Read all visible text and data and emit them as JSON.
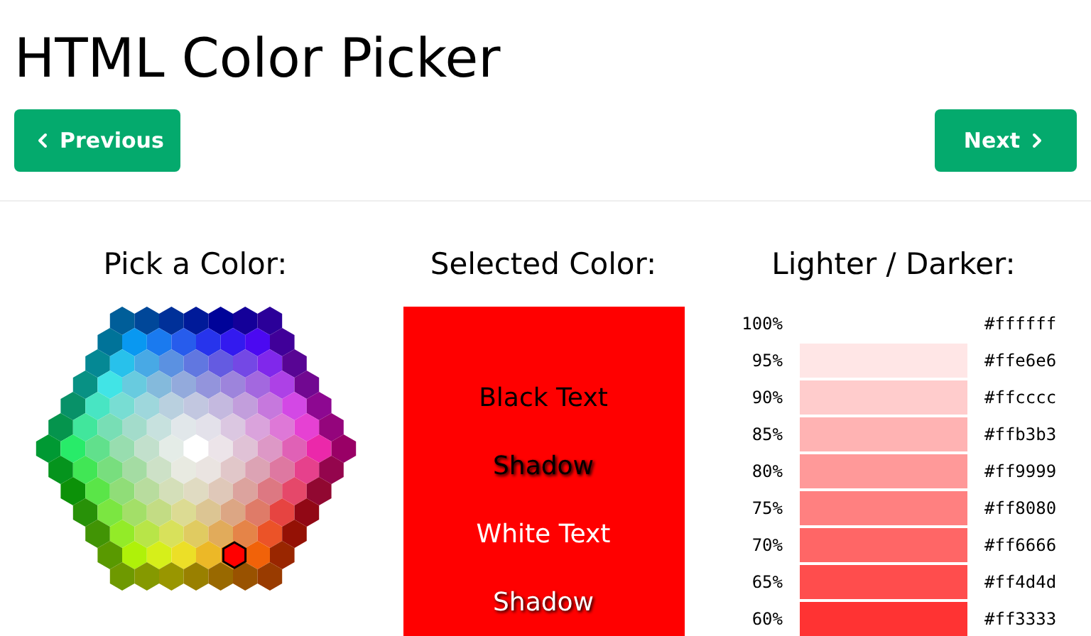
{
  "title": "HTML Color Picker",
  "nav": {
    "previous": "Previous",
    "next": "Next"
  },
  "picker": {
    "heading": "Pick a Color:"
  },
  "selected": {
    "heading": "Selected Color:",
    "color": "#ff0000",
    "samples": [
      {
        "label": "Black Text",
        "kind": "dark"
      },
      {
        "label": "Shadow",
        "kind": "dark-shadow"
      },
      {
        "label": "White Text",
        "kind": "light"
      },
      {
        "label": "Shadow",
        "kind": "light-shadow"
      }
    ]
  },
  "shades": {
    "heading": "Lighter / Darker:",
    "rows": [
      {
        "percent": "100%",
        "hex": "#ffffff"
      },
      {
        "percent": "95%",
        "hex": "#ffe6e6",
        "color": "#ffe6e6"
      },
      {
        "percent": "90%",
        "hex": "#ffcccc",
        "color": "#ffcccc"
      },
      {
        "percent": "85%",
        "hex": "#ffb3b3",
        "color": "#ffb3b3"
      },
      {
        "percent": "80%",
        "hex": "#ff9999",
        "color": "#ff9999"
      },
      {
        "percent": "75%",
        "hex": "#ff8080",
        "color": "#ff8080"
      },
      {
        "percent": "70%",
        "hex": "#ff6666",
        "color": "#ff6666"
      },
      {
        "percent": "65%",
        "hex": "#ff4d4d",
        "color": "#ff4d4d"
      },
      {
        "percent": "60%",
        "hex": "#ff3333",
        "color": "#ff3333"
      }
    ]
  }
}
